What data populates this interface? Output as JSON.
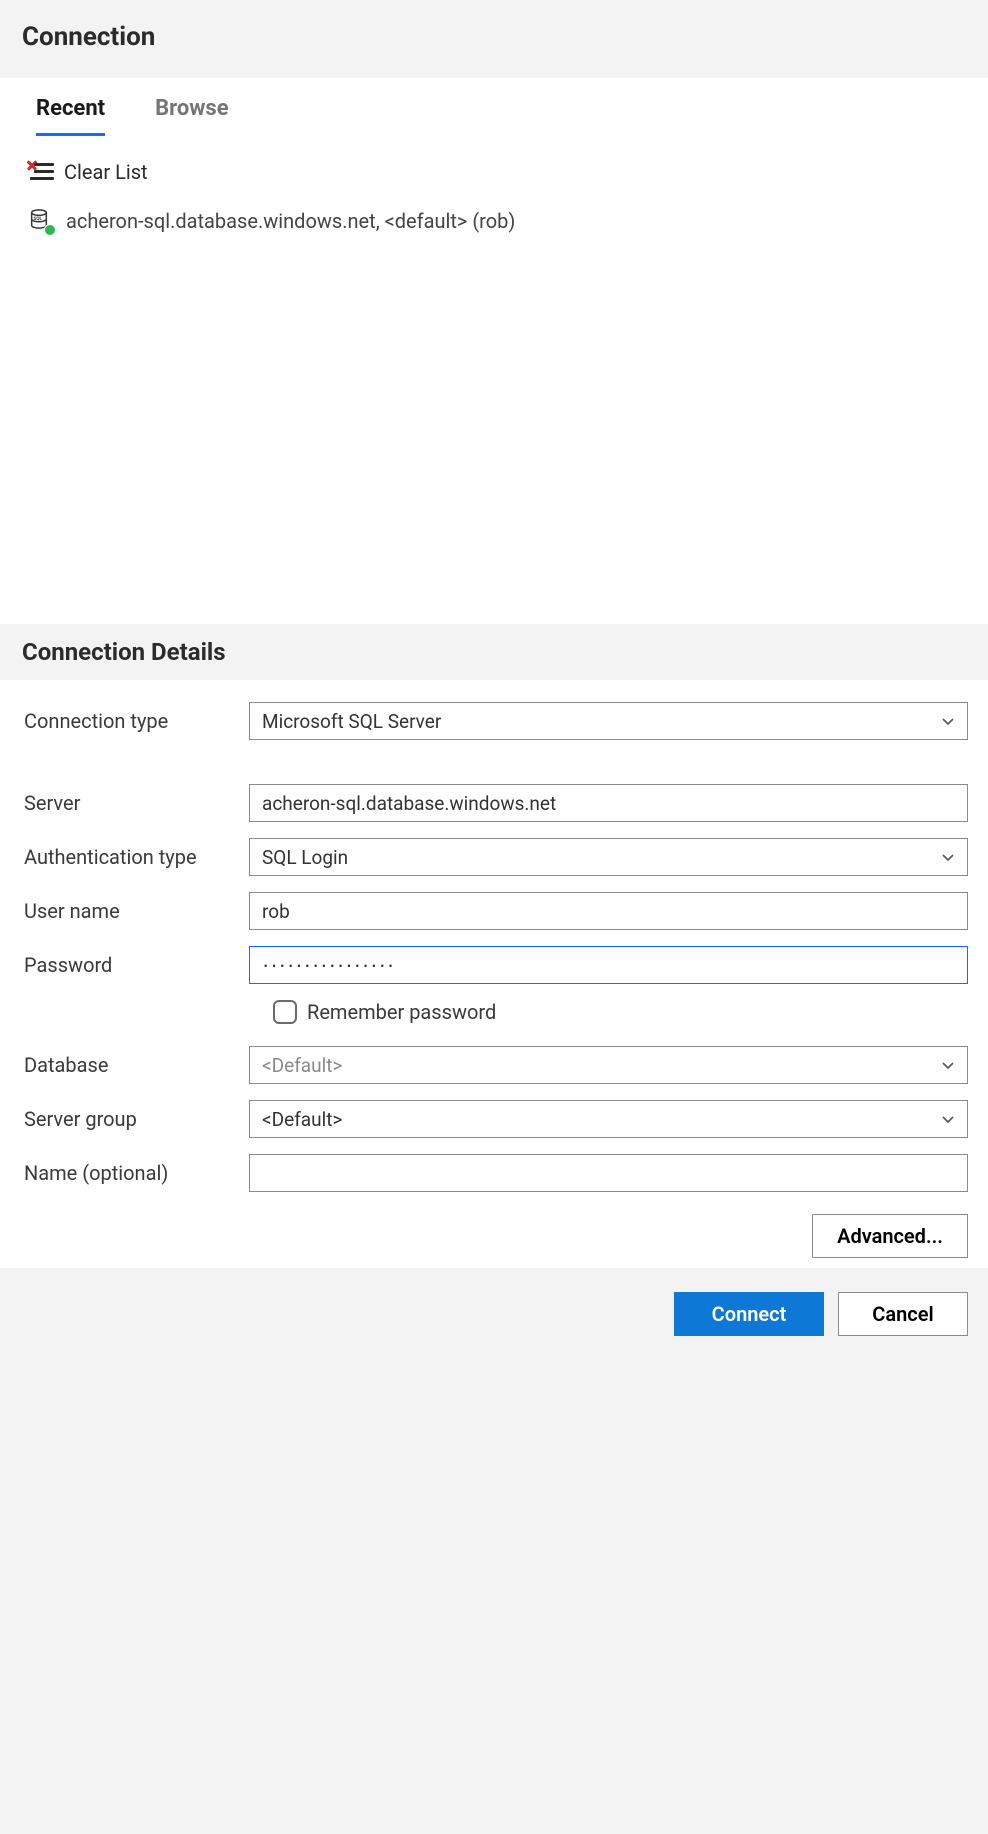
{
  "header": {
    "title": "Connection"
  },
  "tabs": {
    "recent": "Recent",
    "browse": "Browse"
  },
  "list": {
    "clear_label": "Clear List",
    "recent_item": "acheron-sql.database.windows.net, <default> (rob)"
  },
  "details": {
    "title": "Connection Details",
    "labels": {
      "connection_type": "Connection type",
      "server": "Server",
      "auth_type": "Authentication type",
      "username": "User name",
      "password": "Password",
      "remember": "Remember password",
      "database": "Database",
      "server_group": "Server group",
      "name_optional": "Name (optional)"
    },
    "values": {
      "connection_type": "Microsoft SQL Server",
      "server": "acheron-sql.database.windows.net",
      "auth_type": "SQL Login",
      "username": "rob",
      "password_mask": "················",
      "database": "<Default>",
      "server_group": "<Default>",
      "name": ""
    },
    "advanced_label": "Advanced..."
  },
  "footer": {
    "connect": "Connect",
    "cancel": "Cancel"
  }
}
